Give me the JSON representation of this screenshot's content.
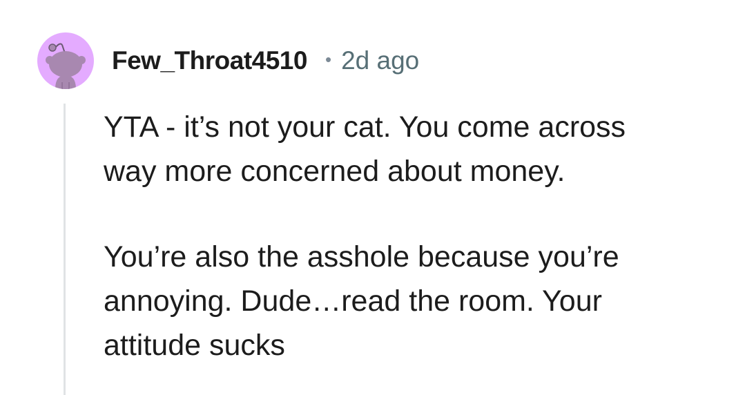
{
  "comment": {
    "avatar_icon": "snoo-avatar-icon",
    "avatar_bg": "#e4abff",
    "username": "Few_Throat4510",
    "separator": "•",
    "timestamp": "2d ago",
    "paragraphs": [
      {
        "lines": [
          "YTA - it’s not your cat. You come across",
          "way more concerned about money."
        ]
      },
      {
        "lines": [
          "You’re also the asshole because you’re",
          "annoying. Dude…read the room. Your",
          "attitude sucks"
        ]
      }
    ]
  }
}
